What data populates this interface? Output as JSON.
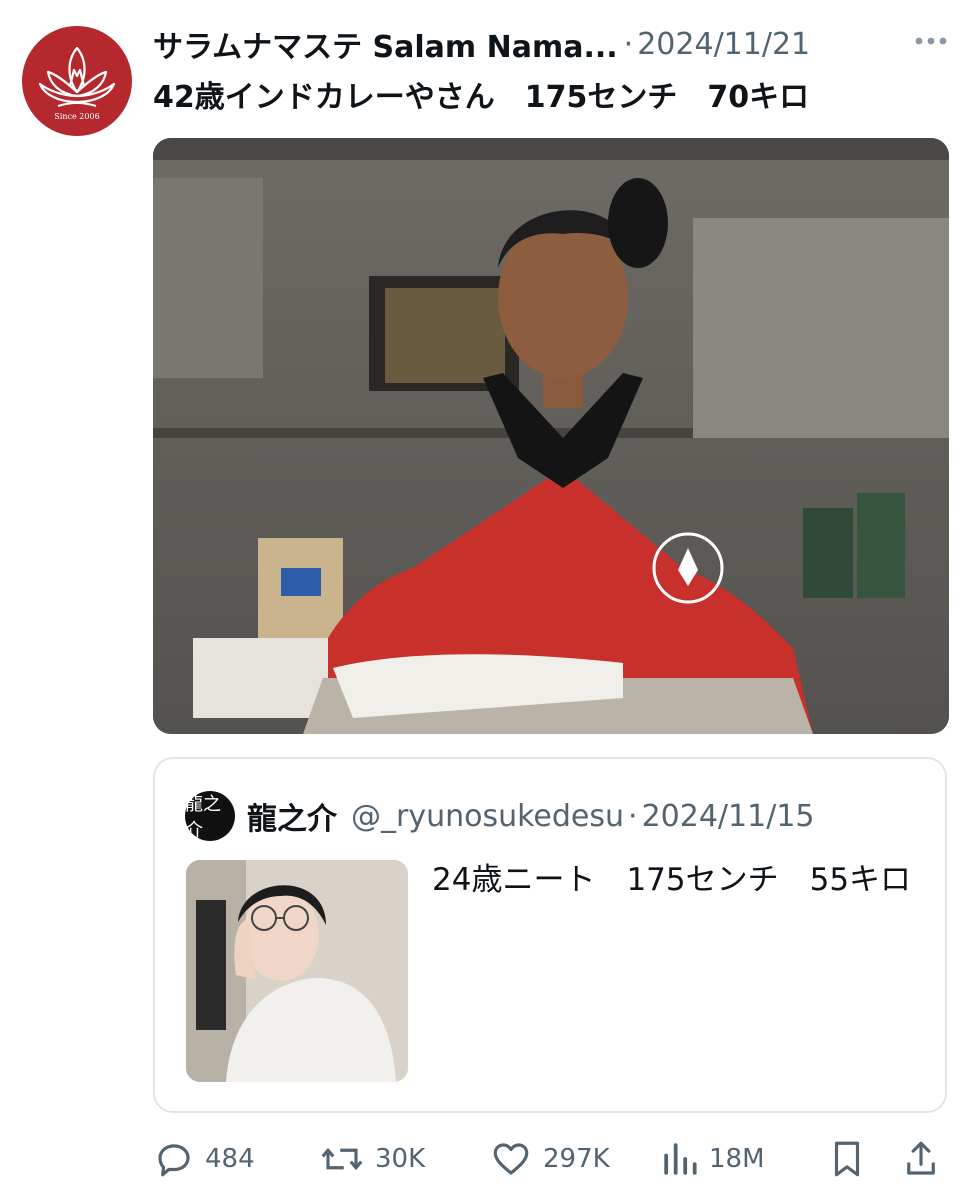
{
  "post": {
    "display_name": "サラムナマステ Salam Nama...",
    "separator": "·",
    "date": "2024/11/21",
    "text": "42歳インドカレーやさん　175センチ　70キロ",
    "avatar_caption": "Since 2006"
  },
  "quote": {
    "avatar_text": "龍之介",
    "display_name": "龍之介",
    "handle": "@_ryunosukedesu",
    "separator": "·",
    "date": "2024/11/15",
    "text": "24歳ニート　175センチ　55キロ"
  },
  "actions": {
    "replies": "484",
    "reposts": "30K",
    "likes": "297K",
    "views": "18M"
  },
  "icons": {
    "more": "more-dots-icon",
    "reply": "speech-bubble-icon",
    "repost": "repost-arrows-icon",
    "like": "heart-icon",
    "views": "bar-chart-icon",
    "bookmark": "bookmark-icon",
    "share": "share-upload-icon"
  },
  "colors": {
    "brand_red": "#b5292e",
    "text_primary": "#0f1419",
    "text_secondary": "#536471",
    "border": "#e1e5e8"
  }
}
